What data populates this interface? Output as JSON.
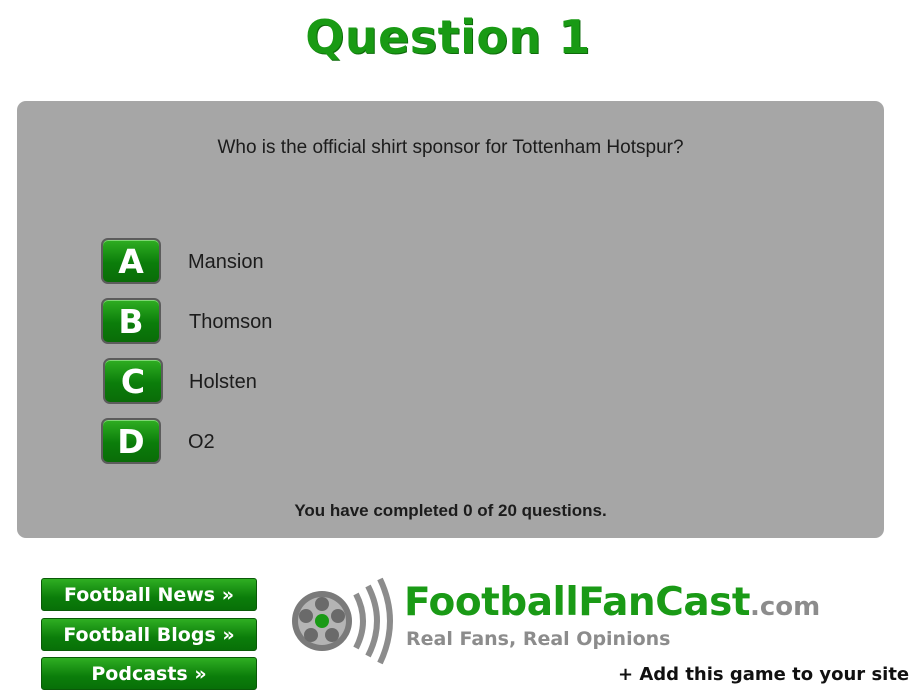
{
  "title": "Question 1",
  "question": "Who is the official shirt sponsor for Tottenham Hotspur?",
  "answers": [
    {
      "letter": "A",
      "text": "Mansion"
    },
    {
      "letter": "B",
      "text": "Thomson"
    },
    {
      "letter": "C",
      "text": "Holsten"
    },
    {
      "letter": "D",
      "text": "O2"
    }
  ],
  "progress": "You have completed 0 of 20 questions.",
  "nav": [
    {
      "label": "Football News »"
    },
    {
      "label": "Football Blogs »"
    },
    {
      "label": "Podcasts »"
    }
  ],
  "logo": {
    "name": "FootballFanCast",
    "tld": ".com",
    "tagline": "Real Fans, Real Opinions",
    "icon": "football-signal-icon"
  },
  "add_game": "+ Add this game to your site",
  "colors": {
    "brand_green": "#1a9a16",
    "panel_gray": "#a6a6a6",
    "logo_gray": "#8c8c8c"
  }
}
